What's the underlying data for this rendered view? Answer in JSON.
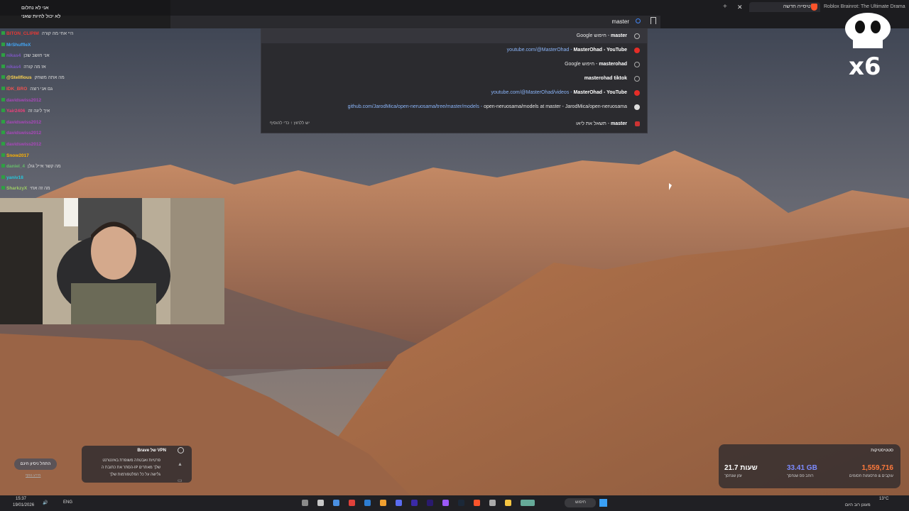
{
  "browser": {
    "tabs": [
      {
        "label": "כרטיסייה חדשה",
        "active": true
      },
      {
        "label": "Roblox Brainrot: The Ultimate Drama",
        "active": false
      }
    ],
    "url_text": "master"
  },
  "omnibox": {
    "suggestions": [
      {
        "icon": "search-icon",
        "prefix": "",
        "text": "Google חיפוש - ",
        "bold": "master"
      },
      {
        "icon": "youtube-icon",
        "prefix": "youtube.com/@MasterOhad - ",
        "text": "",
        "bold": "MasterOhad - YouTube"
      },
      {
        "icon": "history-icon",
        "prefix": "",
        "text": "Google חיפוש - ",
        "bold": "masterohad"
      },
      {
        "icon": "history-icon",
        "prefix": "",
        "text": "",
        "bold": "masterohad tiktok"
      },
      {
        "icon": "youtube-icon",
        "prefix": "youtube.com/@MasterOhad/videos - ",
        "text": "",
        "bold": "MasterOhad - YouTube"
      },
      {
        "icon": "github-icon",
        "prefix": "github.com/JarodMica/open-neruosama/tree/master/models - ",
        "text": "open-neruosama/models at master - JarodMica/open-neruosama",
        "bold": ""
      },
      {
        "icon": "favicon-icon",
        "prefix": "",
        "text": "תשאל את ליאו - ",
        "bold": "master"
      }
    ],
    "hint": "יש ללחוץ ↑ כדי להוסיף"
  },
  "chat": {
    "header_title": "אני לא נחלום",
    "header_sub": "לא יכול להיות שאני",
    "lines": [
      {
        "user": "BITON_CLIPIM",
        "color": "#e53935",
        "msg": "היי אחי מה קורה"
      },
      {
        "user": "MrShuffleX",
        "color": "#42a5f5",
        "msg": ""
      },
      {
        "user": "nikas4",
        "color": "#7e57c2",
        "msg": "אני חושב שכן"
      },
      {
        "user": "nikas4",
        "color": "#7e57c2",
        "msg": "אז מה קורה"
      },
      {
        "user": "@Stellfious",
        "color": "#ffd54f",
        "msg": "מה אתה משחק"
      },
      {
        "user": "IDK_BRO",
        "color": "#ef5350",
        "msg": "גם אני רוצה"
      },
      {
        "user": "davidswiss2012",
        "color": "#ab47bc",
        "msg": ""
      },
      {
        "user": "Yair2406",
        "color": "#ec407a",
        "msg": "איך ליגה זה"
      },
      {
        "user": "davidswiss2012",
        "color": "#ab47bc",
        "msg": ""
      },
      {
        "user": "davidswiss2012",
        "color": "#ab47bc",
        "msg": ""
      },
      {
        "user": "davidswiss2012",
        "color": "#ab47bc",
        "msg": ""
      },
      {
        "user": "Snow2017",
        "color": "#ffb300",
        "msg": ""
      },
      {
        "user": "daniel_4",
        "color": "#66bb6a",
        "msg": "מה קשר אייל גולן"
      },
      {
        "user": "yaniv18",
        "color": "#26c6da",
        "msg": ""
      },
      {
        "user": "SharkzyX",
        "color": "#9ccc65",
        "msg": "מה זה אחי"
      }
    ]
  },
  "overlay": {
    "multiplier": "x6"
  },
  "vpn_popup": {
    "title": "Brave של VPN",
    "lines": [
      "פרטיות ואבטחה משופרת באינטרנט",
      "הסתר את כתובת ה-IP שלך מאתרים",
      "גלישה על כל הפלטפורמות שלך"
    ],
    "button": "התחל ניסיון חינם",
    "link": "מידע נוסף"
  },
  "stats_widget": {
    "title": "סטטיסטיקות",
    "items": [
      {
        "value": "1,559,716",
        "label": "עוקבים & פרסומות חסומים",
        "color": "#ff7a3c"
      },
      {
        "value": "33.41 GB",
        "label": "רוחב פס שנחסך",
        "color": "#7c8bff"
      },
      {
        "value": "21.7 שעות",
        "label": "זמן שנחסך",
        "color": "#ffffff"
      }
    ]
  },
  "taskbar": {
    "time": "15:37",
    "date": "19/01/2026",
    "lang": "ENG",
    "search_placeholder": "חיפוש",
    "weather_temp": "13°C",
    "weather_desc": "מעונן רוב היום"
  }
}
